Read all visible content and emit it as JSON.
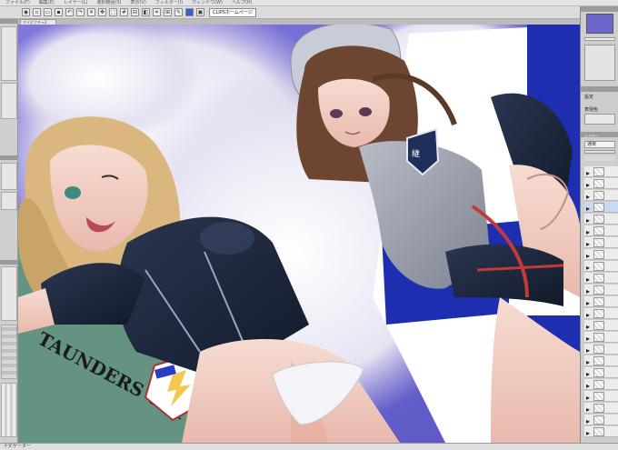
{
  "menubar": {
    "items": [
      "ファイル(F)",
      "編集(E)",
      "レイヤー(L)",
      "選択範囲(S)",
      "表示(V)",
      "フィルター(I)",
      "ウィンドウ(W)",
      "ヘルプ(H)"
    ]
  },
  "toolbar": {
    "home_button_label": "CLIPSホームページ"
  },
  "document": {
    "tab_title": "マイピクチャ2"
  },
  "artwork": {
    "shirt_text": "TAUNDERS UNIVE"
  },
  "right_panel": {
    "property_label": "設定",
    "color_label": "表現色",
    "layer_label": "レイヤー",
    "layer_mode": "通常"
  },
  "status": {
    "zoom_label": "ナビゲーター"
  },
  "colors": {
    "sky_blue": "#6f6cd0",
    "swimsuit_navy": "#1c2538",
    "ui_gray": "#cdcdcd"
  }
}
